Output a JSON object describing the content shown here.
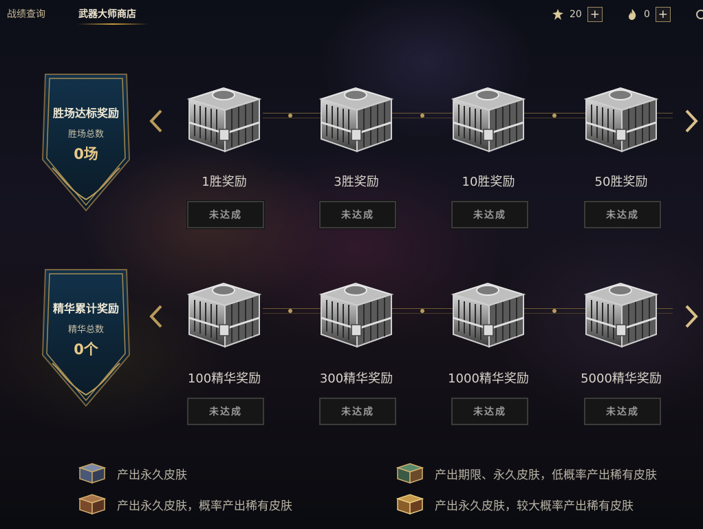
{
  "tabs": [
    {
      "label": "战绩查询",
      "active": false
    },
    {
      "label": "武器大师商店",
      "active": true
    }
  ],
  "currencies": [
    {
      "icon": "weapon-token-icon",
      "value": "20",
      "plus": "+"
    },
    {
      "icon": "flame-essence-icon",
      "value": "0",
      "plus": "+"
    }
  ],
  "sections": [
    {
      "title": "胜场达标奖励",
      "subtitle": "胜场总数",
      "value": "0场",
      "rewards": [
        {
          "label": "1胜奖励",
          "status": "未达成"
        },
        {
          "label": "3胜奖励",
          "status": "未达成"
        },
        {
          "label": "10胜奖励",
          "status": "未达成"
        },
        {
          "label": "50胜奖励",
          "status": "未达成"
        }
      ]
    },
    {
      "title": "精华累计奖励",
      "subtitle": "精华总数",
      "value": "0个",
      "rewards": [
        {
          "label": "100精华奖励",
          "status": "未达成"
        },
        {
          "label": "300精华奖励",
          "status": "未达成"
        },
        {
          "label": "1000精华奖励",
          "status": "未达成"
        },
        {
          "label": "5000精华奖励",
          "status": "未达成"
        }
      ]
    }
  ],
  "legend": [
    {
      "label": "产出永久皮肤",
      "color": "#5a6a8a"
    },
    {
      "label": "产出永久皮肤，概率产出稀有皮肤",
      "color": "#8a5a3a"
    },
    {
      "label": "产出期限、永久皮肤，低概率产出稀有皮肤",
      "color": "#4a7a5a"
    },
    {
      "label": "产出永久皮肤，较大概率产出稀有皮肤",
      "color": "#9a7a3a"
    }
  ],
  "colors": {
    "gold": "#c89b3c",
    "banner_bg": "#0e2433"
  }
}
